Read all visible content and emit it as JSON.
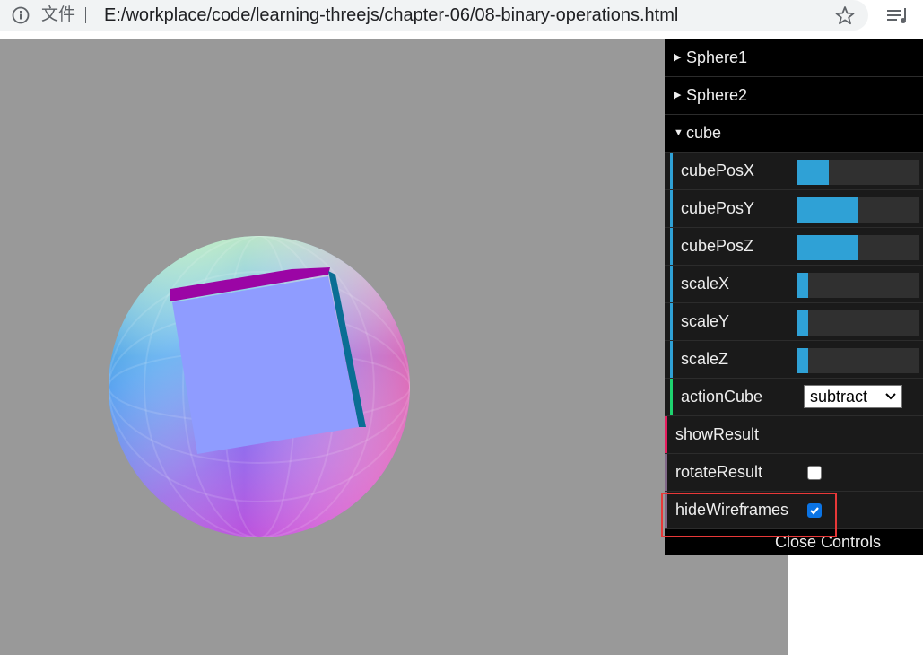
{
  "browser": {
    "file_label": "文件",
    "url": "E:/workplace/code/learning-threejs/chapter-06/08-binary-operations.html"
  },
  "gui": {
    "folders": [
      {
        "title": "Sphere1",
        "expanded": false
      },
      {
        "title": "Sphere2",
        "expanded": false
      },
      {
        "title": "cube",
        "expanded": true
      }
    ],
    "cube_controls": [
      {
        "label": "cubePosX",
        "value_fraction": 0.26
      },
      {
        "label": "cubePosY",
        "value_fraction": 0.5
      },
      {
        "label": "cubePosZ",
        "value_fraction": 0.5
      },
      {
        "label": "scaleX",
        "value_fraction": 0.09
      },
      {
        "label": "scaleY",
        "value_fraction": 0.09
      },
      {
        "label": "scaleZ",
        "value_fraction": 0.09
      }
    ],
    "action_cube": {
      "label": "actionCube",
      "selected": "subtract"
    },
    "show_result": {
      "label": "showResult"
    },
    "rotate_result": {
      "label": "rotateResult",
      "checked": false
    },
    "hide_wireframes": {
      "label": "hideWireframes",
      "checked": true
    },
    "close_label": "Close Controls"
  },
  "colors": {
    "viewport_bg": "#999999",
    "slider_fill": "#2fa1d6",
    "number_stripe": "#2fa1d6",
    "select_stripe": "#1ed36f",
    "function_stripe": "#e61d5f",
    "boolean_stripe": "#806787",
    "highlight": "#e83838"
  }
}
